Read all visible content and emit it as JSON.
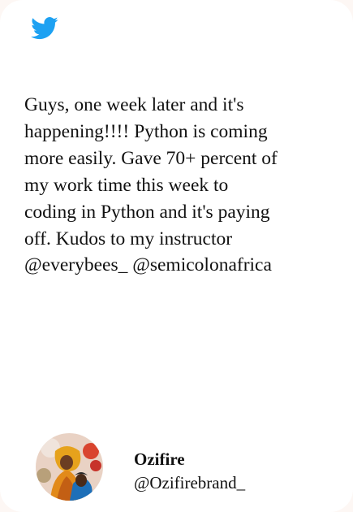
{
  "tweet": {
    "icon": "twitter-bird-icon",
    "brand_color": "#1DA1F2",
    "text": "Guys, one week later and it's\nhappening!!!! Python is coming\nmore easily. Gave 70+ percent of\nmy work time this week to\ncoding in Python and it's paying\noff. Kudos to my instructor\n@everybees_ @semicolonafrica"
  },
  "author": {
    "name": "Ozifire",
    "handle": "@Ozifirebrand_",
    "avatar_icon": "profile-photo"
  }
}
